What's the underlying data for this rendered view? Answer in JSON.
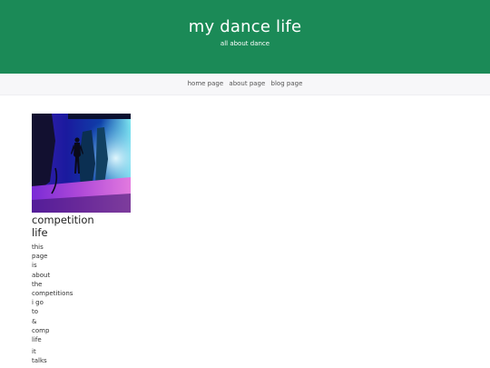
{
  "header": {
    "title": "my dance life",
    "tagline": "all about dance",
    "background_color": "#1b8a57"
  },
  "nav": {
    "items": [
      {
        "label": "home page"
      },
      {
        "label": "about page"
      },
      {
        "label": "blog page"
      }
    ]
  },
  "post": {
    "image_alt": "dancer on a stage with blue and purple lighting",
    "title": "competition life",
    "paragraph1_words": [
      "this",
      "page",
      "is",
      "about",
      "the",
      "competitions",
      "i go",
      "to",
      "&",
      "comp",
      "life"
    ],
    "paragraph2_words": [
      "it",
      "talks"
    ]
  }
}
